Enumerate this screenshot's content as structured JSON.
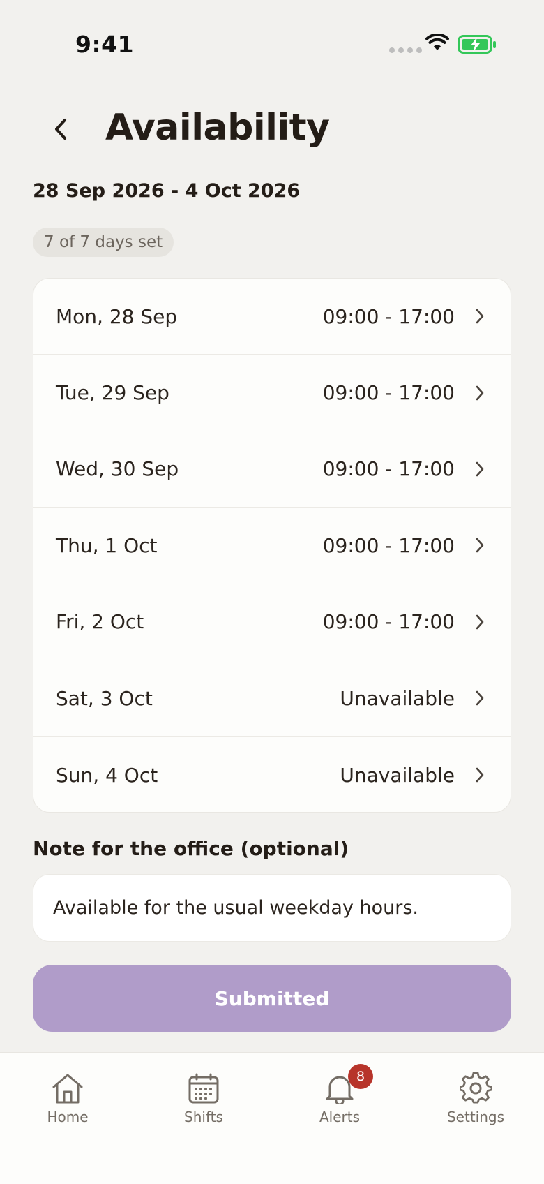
{
  "status_bar": {
    "time": "9:41",
    "icons": [
      "signal-dots-icon",
      "wifi-icon",
      "battery-charging-icon"
    ],
    "battery_color": "#34c759"
  },
  "header": {
    "back_icon": "chevron-left-icon",
    "title": "Availability"
  },
  "week": {
    "date_range": "28 Sep 2026 - 4 Oct 2026",
    "progress_badge": "7 of 7 days set"
  },
  "days": [
    {
      "day": "Mon, 28 Sep",
      "value": "09:00 - 17:00"
    },
    {
      "day": "Tue, 29 Sep",
      "value": "09:00 - 17:00"
    },
    {
      "day": "Wed, 30 Sep",
      "value": "09:00 - 17:00"
    },
    {
      "day": "Thu, 1 Oct",
      "value": "09:00 - 17:00"
    },
    {
      "day": "Fri, 2 Oct",
      "value": "09:00 - 17:00"
    },
    {
      "day": "Sat, 3 Oct",
      "value": "Unavailable"
    },
    {
      "day": "Sun, 4 Oct",
      "value": "Unavailable"
    }
  ],
  "note": {
    "label": "Note for the office (optional)",
    "value": "Available for the usual weekday hours."
  },
  "submit": {
    "label": "Submitted",
    "color": "#b09cc9"
  },
  "tab_bar": {
    "tabs": [
      {
        "label": "Home",
        "icon": "home-icon"
      },
      {
        "label": "Shifts",
        "icon": "calendar-icon"
      },
      {
        "label": "Alerts",
        "icon": "bell-icon",
        "badge": "8"
      },
      {
        "label": "Settings",
        "icon": "gear-icon"
      }
    ],
    "badge_color": "#b7342a"
  }
}
